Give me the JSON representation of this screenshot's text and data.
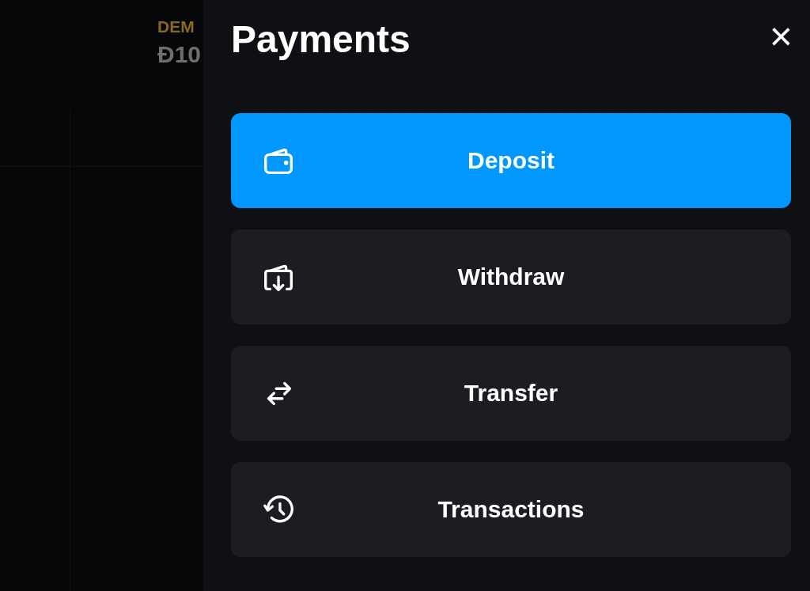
{
  "background": {
    "account_label": "DEM",
    "balance": "Đ10"
  },
  "panel": {
    "title": "Payments",
    "close": "×",
    "actions": [
      {
        "label": "Deposit",
        "kind": "wallet",
        "selected": true
      },
      {
        "label": "Withdraw",
        "kind": "withdraw",
        "selected": false
      },
      {
        "label": "Transfer",
        "kind": "transfer",
        "selected": false
      },
      {
        "label": "Transactions",
        "kind": "history",
        "selected": false
      }
    ]
  }
}
